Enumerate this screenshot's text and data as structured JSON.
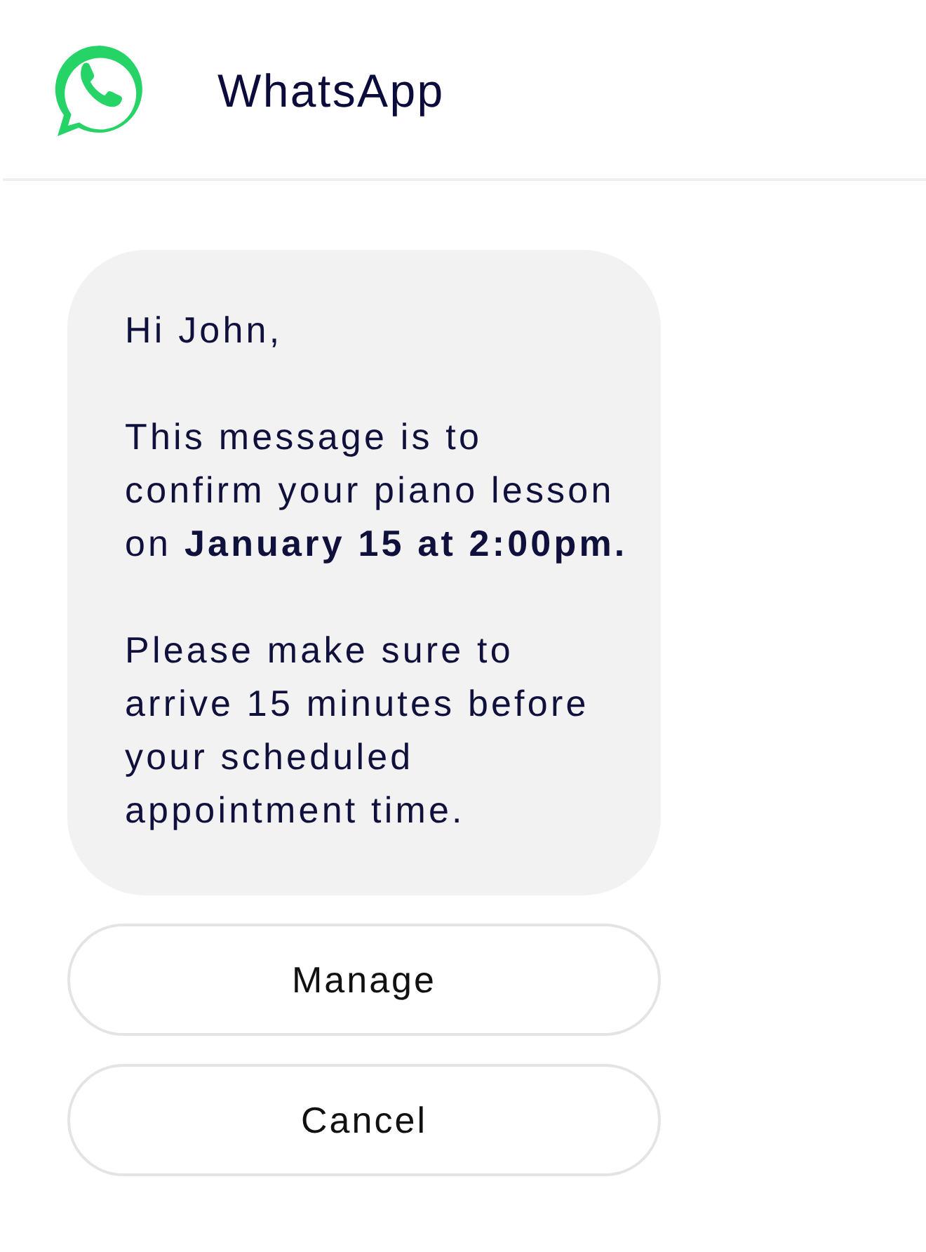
{
  "header": {
    "title": "WhatsApp"
  },
  "message": {
    "paragraphs": [
      "Hi John,",
      "This message is to confirm your piano lesson on **January 15 at 2:00pm.**",
      "Please make sure to arrive 15 minutes before your scheduled appointment time."
    ]
  },
  "buttons": [
    {
      "label": "Manage"
    },
    {
      "label": "Cancel"
    }
  ]
}
